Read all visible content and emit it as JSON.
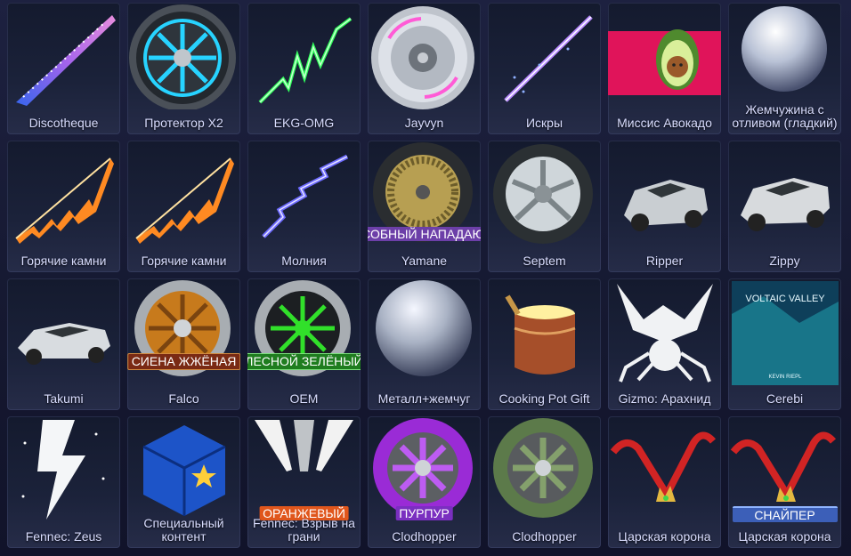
{
  "items": [
    {
      "name": "Discotheque",
      "icon": "trail-icon"
    },
    {
      "name": "Протектор X2",
      "icon": "wheel-icon"
    },
    {
      "name": "EKG-OMG",
      "icon": "boost-icon"
    },
    {
      "name": "Jayvyn",
      "icon": "wheel-icon"
    },
    {
      "name": "Искры",
      "icon": "trail-icon"
    },
    {
      "name": "Миссис Авокадо",
      "icon": "avocado-decal-icon"
    },
    {
      "name": "Жемчужина с отливом (гладкий)",
      "icon": "paint-finish-icon"
    },
    {
      "name": "Горячие камни",
      "icon": "boost-icon"
    },
    {
      "name": "Горячие камни",
      "icon": "boost-icon"
    },
    {
      "name": "Молния",
      "icon": "trail-icon"
    },
    {
      "name": "Yamane",
      "icon": "wheel-icon",
      "tag": "СПОСОБНЫЙ НАПАДАЮЩИЙ"
    },
    {
      "name": "Septem",
      "icon": "wheel-icon"
    },
    {
      "name": "Ripper",
      "icon": "car-icon"
    },
    {
      "name": "Zippy",
      "icon": "car-icon"
    },
    {
      "name": "Takumi",
      "icon": "car-icon"
    },
    {
      "name": "Falco",
      "icon": "wheel-icon",
      "tag": "СИЕНА ЖЖЁНАЯ"
    },
    {
      "name": "OEM",
      "icon": "wheel-icon",
      "tag": "ЛЕСНОЙ ЗЕЛЁНЫЙ"
    },
    {
      "name": "Металл+жемчуг",
      "icon": "paint-finish-icon"
    },
    {
      "name": "Cooking Pot Gift",
      "icon": "gift-pot-icon"
    },
    {
      "name": "Gizmo: Арахнид",
      "icon": "spider-decal-icon"
    },
    {
      "name": "Cerebi",
      "icon": "music-anthem-icon",
      "art_text": {
        "title": "VOLTAIC VALLEY",
        "artist": "KEVIN RIEPL"
      }
    },
    {
      "name": "Fennec: Zeus",
      "icon": "lightning-decal-icon"
    },
    {
      "name": "Специальный контент",
      "icon": "crate-icon"
    },
    {
      "name": "Fennec: Взрыв на грани",
      "icon": "decal-icon",
      "tag": "ОРАНЖЕВЫЙ"
    },
    {
      "name": "Clodhopper",
      "icon": "wheel-icon",
      "tag": "ПУРПУР"
    },
    {
      "name": "Clodhopper",
      "icon": "wheel-icon"
    },
    {
      "name": "Царская корона",
      "icon": "crown-topper-icon"
    },
    {
      "name": "Царская корона",
      "icon": "crown-topper-icon",
      "tag": "СНАЙПЕР"
    }
  ],
  "colors": {
    "tile_bg": "#1b223a",
    "label": "#d9ddff",
    "tag_brown": "#7a2a14",
    "tag_green": "#1f7d1f",
    "tag_orange": "#e0561c",
    "tag_purple": "#7a2fc0",
    "tag_blue": "#3c5fb8"
  }
}
